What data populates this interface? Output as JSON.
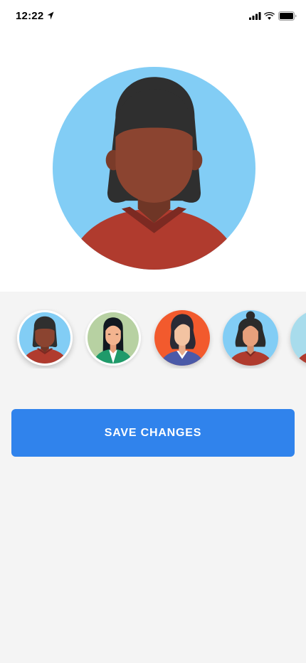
{
  "status_bar": {
    "time": "12:22",
    "icons": [
      "location-arrow-icon",
      "cellular-signal-icon",
      "wifi-icon",
      "battery-icon"
    ]
  },
  "profile": {
    "selected_avatar": "avatar-1"
  },
  "avatars": [
    {
      "id": "avatar-1",
      "bg": "#82cdf5",
      "skin": "#8b4430",
      "hair": "#2f2f2f",
      "shirt": "#b03b2e",
      "selected": true
    },
    {
      "id": "avatar-2",
      "bg": "#b7d1a2",
      "skin": "#f3b48f",
      "hair": "#111820",
      "shirt": "#1f9a6a",
      "selected": false
    },
    {
      "id": "avatar-3",
      "bg": "#f25a2d",
      "skin": "#f3c3a2",
      "hair": "#2a2a35",
      "shirt": "#4b5aa8",
      "selected": false
    },
    {
      "id": "avatar-4",
      "bg": "#82cdf5",
      "skin": "#e6a07c",
      "hair": "#2b2b2b",
      "shirt": "#b03b2e",
      "selected": false
    },
    {
      "id": "avatar-5",
      "bg": "#a8dcec",
      "skin": "#e6a07c",
      "hair": "#2b2b2b",
      "shirt": "#b03b2e",
      "selected": false
    }
  ],
  "actions": {
    "save_label": "SAVE CHANGES"
  },
  "colors": {
    "accent": "#3083ec",
    "bottom_background": "#f4f4f4"
  }
}
